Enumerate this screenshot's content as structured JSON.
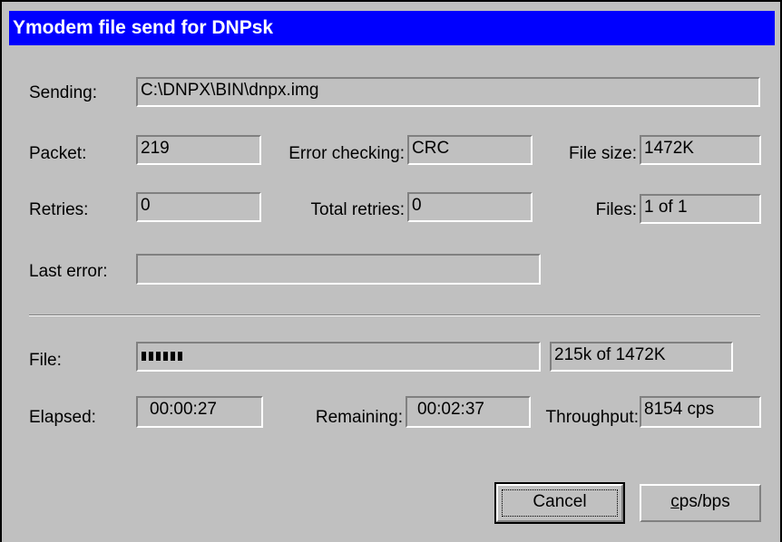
{
  "window": {
    "title": "Ymodem file send for DNPsk"
  },
  "sending": {
    "label": "Sending:",
    "value": "C:\\DNPX\\BIN\\dnpx.img"
  },
  "packet": {
    "label": "Packet:",
    "value": "219"
  },
  "error_checking": {
    "label": "Error checking:",
    "value": "CRC"
  },
  "file_size": {
    "label": "File size:",
    "value": "1472K"
  },
  "retries": {
    "label": "Retries:",
    "value": "0"
  },
  "total_retries": {
    "label": "Total retries:",
    "value": "0"
  },
  "files": {
    "label": "Files:",
    "value": "1 of 1"
  },
  "last_error": {
    "label": "Last error:",
    "value": ""
  },
  "file_progress": {
    "label": "File:",
    "fraction": 0.146,
    "blocks_shown": 6,
    "text": "215k of 1472K"
  },
  "elapsed": {
    "label": "Elapsed:",
    "value": "00:00:27"
  },
  "remaining": {
    "label": "Remaining:",
    "value": "00:02:37"
  },
  "throughput": {
    "label": "Throughput:",
    "value": "8154 cps"
  },
  "buttons": {
    "cancel": "Cancel",
    "cps_bps_first": "c",
    "cps_bps_rest": "ps/bps"
  },
  "colors": {
    "titlebar": "#0000ff",
    "dialog_face": "#c0c0c0"
  }
}
